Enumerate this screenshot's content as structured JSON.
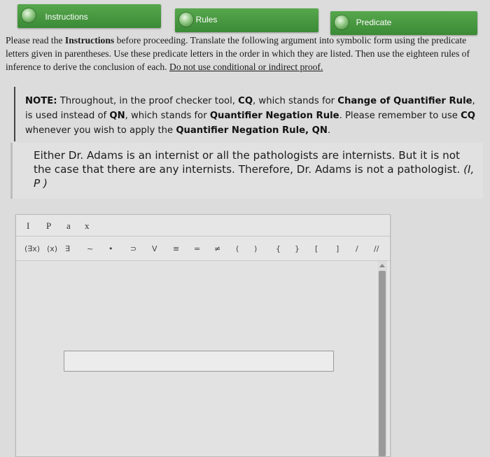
{
  "tabs": {
    "instructions": "Instructions",
    "rules": "Rules",
    "predicate": "Predicate"
  },
  "instructions": {
    "part1": "Please read the ",
    "part1_bold": "Instructions",
    "part2": " before proceeding. Translate the following argument into symbolic form using the predicate letters given in parentheses. Use these predicate letters in the order in which they are listed. Then use the eighteen rules of inference to derive the conclusion of each. ",
    "part3_underlined": "Do not use conditional or indirect proof."
  },
  "note": {
    "label": "NOTE:",
    "text1": " Throughout, in the proof checker tool, ",
    "cq": "CQ",
    "text2": ", which stands for ",
    "cq_full": "Change of Quantifier Rule",
    "text3": ", is used instead of ",
    "qn": "QN",
    "text4": ", which stands for ",
    "qn_full": "Quantifier Negation Rule",
    "text5": ". Please remember to use ",
    "cq2": "CQ",
    "text6": " whenever you wish to apply the ",
    "qn_full2": "Quantifier Negation Rule, QN",
    "text7": "."
  },
  "argument": {
    "text": "Either Dr. Adams is an internist or all the pathologists are internists. But it is not the case that there are any internists. Therefore, Dr. Adams is not a pathologist.",
    "letters": "(I, P )"
  },
  "checker": {
    "letters": [
      "I",
      "P",
      "a",
      "x"
    ],
    "symbols": [
      "(∃x)",
      "(x)",
      "∃",
      "~",
      "•",
      "⊃",
      "V",
      "≡",
      "=",
      "≠",
      "(",
      ")",
      "{",
      "}",
      "[",
      "]",
      "/",
      "//"
    ],
    "input_value": ""
  },
  "colors": {
    "tab_green": "#4a9a42",
    "background": "#dcdcdc"
  }
}
